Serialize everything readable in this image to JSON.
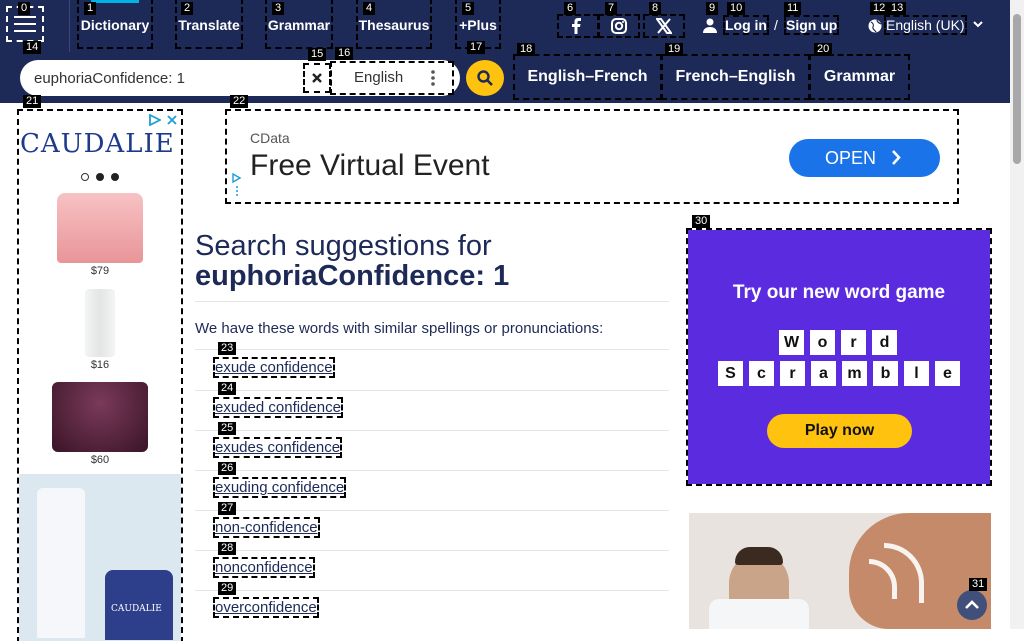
{
  "nav": {
    "dictionary": "Dictionary",
    "translate": "Translate",
    "grammar": "Grammar",
    "thesaurus": "Thesaurus",
    "plus": "+Plus"
  },
  "auth": {
    "login": "Log in",
    "separator": "/",
    "signup": "Sign up"
  },
  "language": "English (UK)",
  "search": {
    "value": "euphoriaConfidence: 1",
    "dictionary": "English"
  },
  "quick_links": [
    "English–French",
    "French–English",
    "Grammar"
  ],
  "ads": {
    "left": {
      "brand": "CAUDALIE",
      "prices": [
        "$79",
        "$16",
        "$60"
      ],
      "bottle_brand": "CAUDALIE"
    },
    "top": {
      "brand": "CData",
      "headline": "Free Virtual Event",
      "cta": "OPEN"
    },
    "right": {
      "title": "Try our new word game",
      "word1": [
        "W",
        "o",
        "r",
        "d"
      ],
      "word2": [
        "S",
        "c",
        "r",
        "a",
        "m",
        "b",
        "l",
        "e"
      ],
      "cta": "Play now"
    }
  },
  "results": {
    "heading_prefix": "Search suggestions for",
    "heading_query": "euphoriaConfidence: 1",
    "intro": "We have these words with similar spellings or pronunciations:",
    "suggestions": [
      "exude confidence",
      "exuded confidence",
      "exudes confidence",
      "exuding confidence",
      "non-confidence",
      "nonconfidence",
      "overconfidence"
    ]
  },
  "labels": [
    "0",
    "1",
    "2",
    "3",
    "4",
    "5",
    "6",
    "7",
    "8",
    "9",
    "10",
    "11",
    "12",
    "13",
    "14",
    "15",
    "16",
    "17",
    "18",
    "19",
    "20",
    "21",
    "22",
    "23",
    "24",
    "25",
    "26",
    "27",
    "28",
    "29",
    "30",
    "31"
  ],
  "colors": {
    "navy": "#1d2a57",
    "yellow": "#ffc20e",
    "purple": "#5b2be0",
    "accent": "#00b3e6"
  },
  "icons": [
    "menu-icon",
    "facebook-icon",
    "instagram-icon",
    "x-icon",
    "user-icon",
    "globe-icon",
    "chevron-down-icon",
    "clear-icon",
    "more-vertical-icon",
    "search-icon",
    "ad-choices-icon",
    "close-icon",
    "chevron-right-icon",
    "chevron-up-icon"
  ]
}
